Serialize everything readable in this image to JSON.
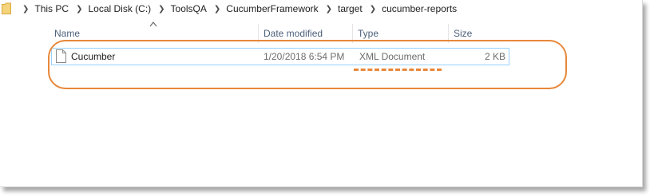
{
  "breadcrumb": [
    "This PC",
    "Local Disk (C:)",
    "ToolsQA",
    "CucumberFramework",
    "target",
    "cucumber-reports"
  ],
  "columns": {
    "name": "Name",
    "date": "Date modified",
    "type": "Type",
    "size": "Size"
  },
  "files": [
    {
      "name": "Cucumber",
      "date": "1/20/2018 6:54 PM",
      "type": "XML Document",
      "size": "2 KB"
    }
  ],
  "icons": {
    "folder": "folder-icon",
    "file": "document-icon",
    "sort": "sort-ascending-icon"
  },
  "colors": {
    "annotation": "#e8883a",
    "row_border": "#99d1ff",
    "header_text": "#4c607a"
  }
}
